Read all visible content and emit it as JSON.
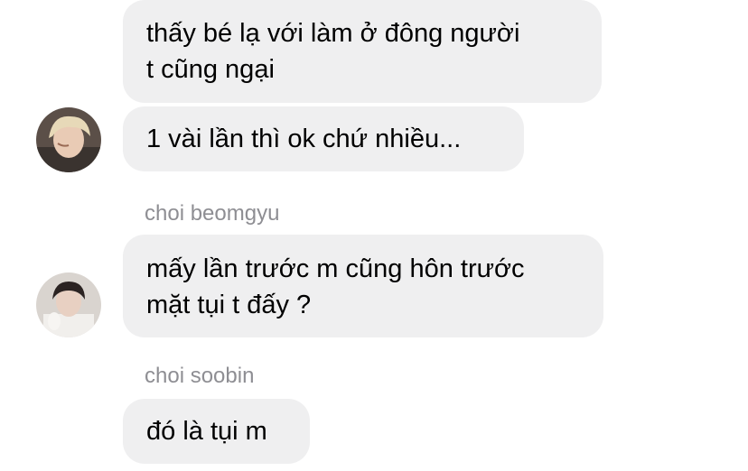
{
  "messages": [
    {
      "id": "msg1",
      "lines": [
        "thấy bé lạ với làm ở đông người",
        "t cũng ngại"
      ]
    },
    {
      "id": "msg2",
      "lines": [
        "1 vài lần thì ok chứ nhiều..."
      ]
    },
    {
      "id": "msg3",
      "sender": "choi beomgyu",
      "lines": [
        "mấy lần trước m cũng hôn trước",
        "mặt tụi t đấy ?"
      ]
    },
    {
      "id": "msg4",
      "sender": "choi soobin",
      "lines": [
        "đó là tụi m"
      ]
    }
  ],
  "colors": {
    "bubble_bg": "#efeff0",
    "sender_name": "#8e8e93",
    "text": "#000000"
  }
}
